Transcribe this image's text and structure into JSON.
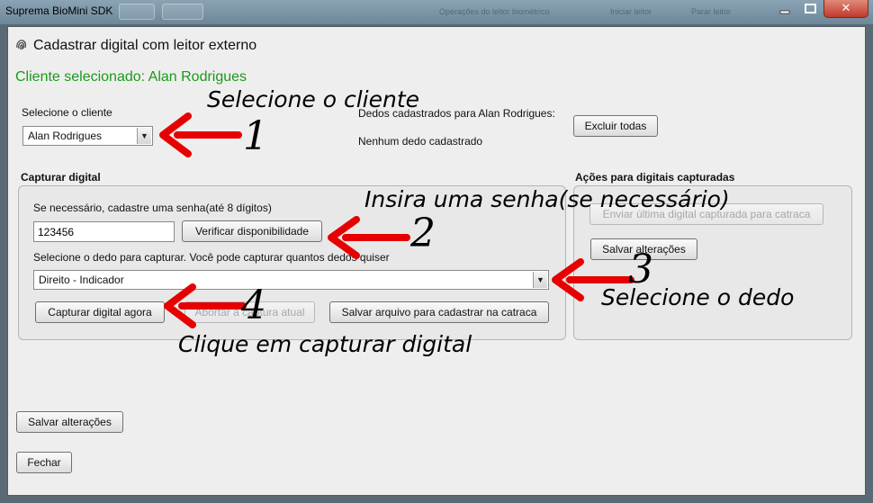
{
  "window": {
    "os_title": "Suprema BioMini SDK",
    "bg_hint_1": "Operações do leitor biométrico",
    "bg_hint_2": "Iniciar leitor",
    "bg_hint_3": "Parar leitor",
    "close_glyph": "✕"
  },
  "dialog": {
    "title": "Cadastrar digital com leitor externo",
    "selected_client": "Cliente selecionado: Alan Rodrigues"
  },
  "client_select": {
    "label": "Selecione o cliente",
    "value": "Alan Rodrigues"
  },
  "registered": {
    "label": "Dedos cadastrados para Alan Rodrigues:",
    "status": "Nenhum dedo cadastrado",
    "delete_all": "Excluir todas"
  },
  "capture": {
    "title": "Capturar digital",
    "password_label": "Se necessário, cadastre uma senha(até 8 dígitos)",
    "password_value": "123456",
    "verify_button": "Verificar disponibilidade",
    "finger_label": "Selecione o dedo para capturar. Você pode capturar quantos dedos quiser",
    "finger_value": "Direito - Indicador",
    "capture_button": "Capturar digital agora",
    "abort_button": "Abortar a captura atual",
    "save_file_button": "Salvar arquivo para cadastrar na catraca"
  },
  "actions": {
    "title": "Ações para digitais capturadas",
    "send_button": "Enviar última digital capturada para catraca",
    "save_button": "Salvar alterações"
  },
  "footer": {
    "save_button": "Salvar alterações",
    "close_button": "Fechar"
  },
  "annotations": {
    "step1_text": "Selecione o cliente",
    "step1_num": "1",
    "step2_text": "Insira uma senha(se necessário)",
    "step2_num": "2",
    "step3_text": "Selecione o dedo",
    "step3_num": "3",
    "step4_text": "Clique em capturar digital",
    "step4_num": "4",
    "arrow_color": "#e60000"
  },
  "colors": {
    "selected_client_text": "#1a9a1a",
    "arrow": "#e60000"
  }
}
